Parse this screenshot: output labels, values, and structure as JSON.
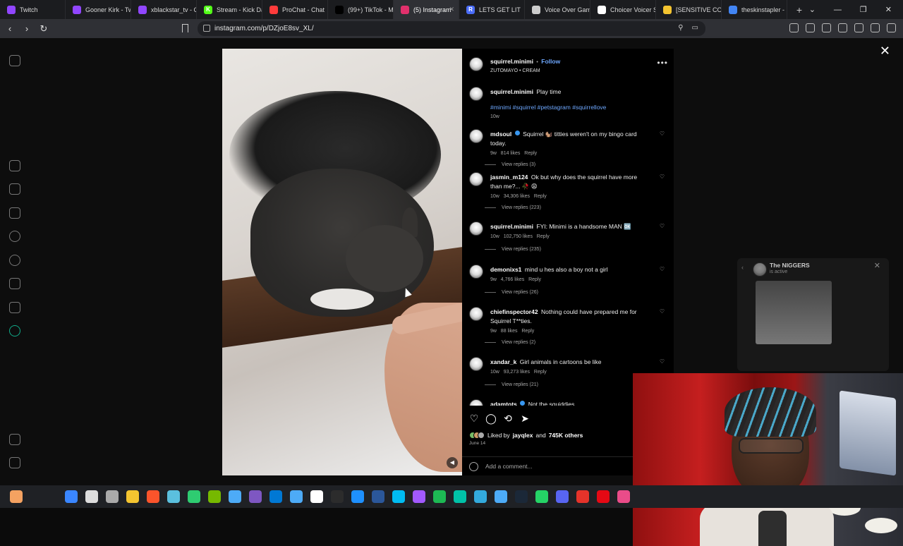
{
  "tabs": [
    {
      "label": "Twitch",
      "color": "#9146ff",
      "glyph": ""
    },
    {
      "label": "Gooner Kirk - Tw",
      "color": "#9146ff",
      "glyph": ""
    },
    {
      "label": "xblackstar_tv - C",
      "color": "#9146ff",
      "glyph": ""
    },
    {
      "label": "Stream - Kick Da",
      "color": "#53fc18",
      "glyph": "K"
    },
    {
      "label": "ProChat - Chat",
      "color": "#ff3b3b",
      "glyph": ""
    },
    {
      "label": "(99+) TikTok - Ma",
      "color": "#000000",
      "glyph": ""
    },
    {
      "label": "(5) Instagram",
      "color": "#e1306c",
      "glyph": "",
      "active": true
    },
    {
      "label": "LETS GET LIT",
      "color": "#4a6cf7",
      "glyph": "R"
    },
    {
      "label": "Voice Over Gam",
      "color": "#cccccc",
      "glyph": ""
    },
    {
      "label": "Choicer Voicer S",
      "color": "#ffffff",
      "glyph": ""
    },
    {
      "label": "[SENSITIVE CON",
      "color": "#f4c430",
      "glyph": ""
    },
    {
      "label": "theskinstapler -",
      "color": "#4285f4",
      "glyph": ""
    }
  ],
  "new_tab": "+",
  "window_controls": {
    "dropdown": "⌄",
    "minimize": "—",
    "restore": "❐",
    "close": "✕"
  },
  "nav": {
    "back": "‹",
    "forward": "›",
    "reload": "↻"
  },
  "url": "instagram.com/p/DZjoE8sv_XL/",
  "overlay_close": "✕",
  "post": {
    "author": "squirrel.minimi",
    "follow": "Follow",
    "separator": "•",
    "audio": "ZUTOMAYO • CREAM",
    "more": "•••",
    "caption_author": "squirrel.minimi",
    "caption_text": "Play time",
    "hashtags": "#minimi #squirrel #petstagram #squirrellove",
    "caption_time": "10w"
  },
  "comments": [
    {
      "user": "mdsoul",
      "verified": true,
      "text": "Squirrel 🐿️ titties weren't on my bingo card today.",
      "time": "9w",
      "likes": "814 likes",
      "reply": "Reply",
      "replies": "View replies (3)"
    },
    {
      "user": "jasmin_m124",
      "verified": false,
      "text": "Ok but why does the squirrel have more than me?... 🥀 😩",
      "time": "10w",
      "likes": "34,306 likes",
      "reply": "Reply",
      "replies": "View replies (223)"
    },
    {
      "user": "squirrel.minimi",
      "verified": false,
      "text": "FYI: Minimi is a handsome MAN 🆗",
      "time": "10w",
      "likes": "102,750 likes",
      "reply": "Reply",
      "replies": "View replies (235)"
    },
    {
      "user": "demonixs1",
      "verified": false,
      "text": "mind u hes also a boy not a girl",
      "time": "9w",
      "likes": "4,766 likes",
      "reply": "Reply",
      "replies": "View replies (26)"
    },
    {
      "user": "chiefinspector42",
      "verified": false,
      "text": "Nothing could have prepared me for Squirrel T**ties.",
      "time": "9w",
      "likes": "88 likes",
      "reply": "Reply",
      "replies": "View replies (2)"
    },
    {
      "user": "xandar_k",
      "verified": false,
      "text": "Girl animals in cartoons be like",
      "time": "10w",
      "likes": "93,273 likes",
      "reply": "Reply",
      "replies": "View replies (21)"
    },
    {
      "user": "adamtots",
      "verified": true,
      "text": "Not the squiddies",
      "time": "",
      "likes": "",
      "reply": "",
      "replies": ""
    }
  ],
  "liked_by": {
    "prefix": "Liked by",
    "user": "jayqlex",
    "mid": "and",
    "others": "745K others"
  },
  "post_date": "June 14",
  "add_comment": "Add a comment...",
  "mini_player": {
    "title": "The NIGGERS",
    "subtitle": "is active"
  },
  "colors": {
    "accent": "#6ea8ff",
    "verified": "#3897f0",
    "panel_bg": "#000000"
  }
}
